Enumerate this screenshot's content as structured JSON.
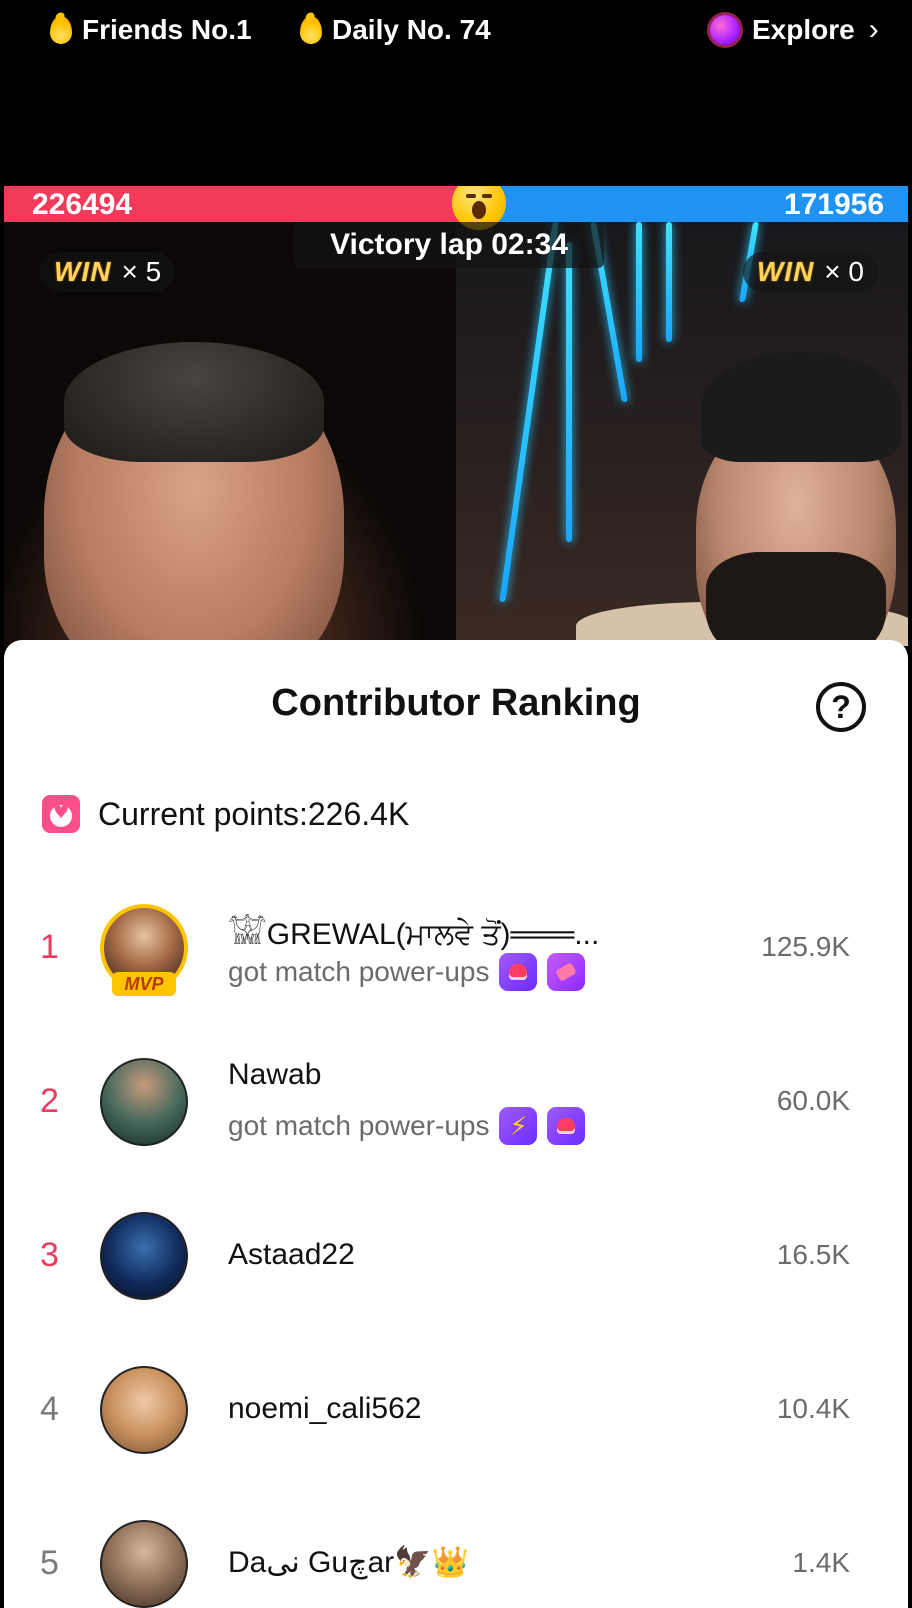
{
  "topbar": {
    "friends": "Friends No.1",
    "daily": "Daily No. 74",
    "explore": "Explore"
  },
  "battle": {
    "score_left": "226494",
    "score_right": "171956",
    "victory_text": "Victory lap 02:34",
    "win_word": "WIN",
    "win_left": "× 5",
    "win_right": "× 0",
    "colors": {
      "red": "#f23b5a",
      "blue": "#1f93f2",
      "gold": "#ffd35c"
    }
  },
  "sheet": {
    "title": "Contributor Ranking",
    "help_glyph": "?",
    "points_label": "Current points:226.4K"
  },
  "contributors": [
    {
      "rank": "1",
      "name": "𓀬GREWAL(ਮਾਲਵੇ ਤੋਂ)═══...",
      "sub": "got match power-ups",
      "score": "125.9K",
      "mvp": "MVP",
      "powerups": [
        "glove-icon",
        "hammer-icon"
      ]
    },
    {
      "rank": "2",
      "name": "Nawab",
      "sub": "got match power-ups",
      "score": "60.0K",
      "powerups": [
        "lightning-icon",
        "glove-icon"
      ]
    },
    {
      "rank": "3",
      "name": "Astaad22",
      "score": "16.5K"
    },
    {
      "rank": "4",
      "name": "noemi_cali562",
      "score": "10.4K"
    },
    {
      "rank": "5",
      "name": "Daنی Guچar🦅👑",
      "score": "1.4K"
    }
  ]
}
